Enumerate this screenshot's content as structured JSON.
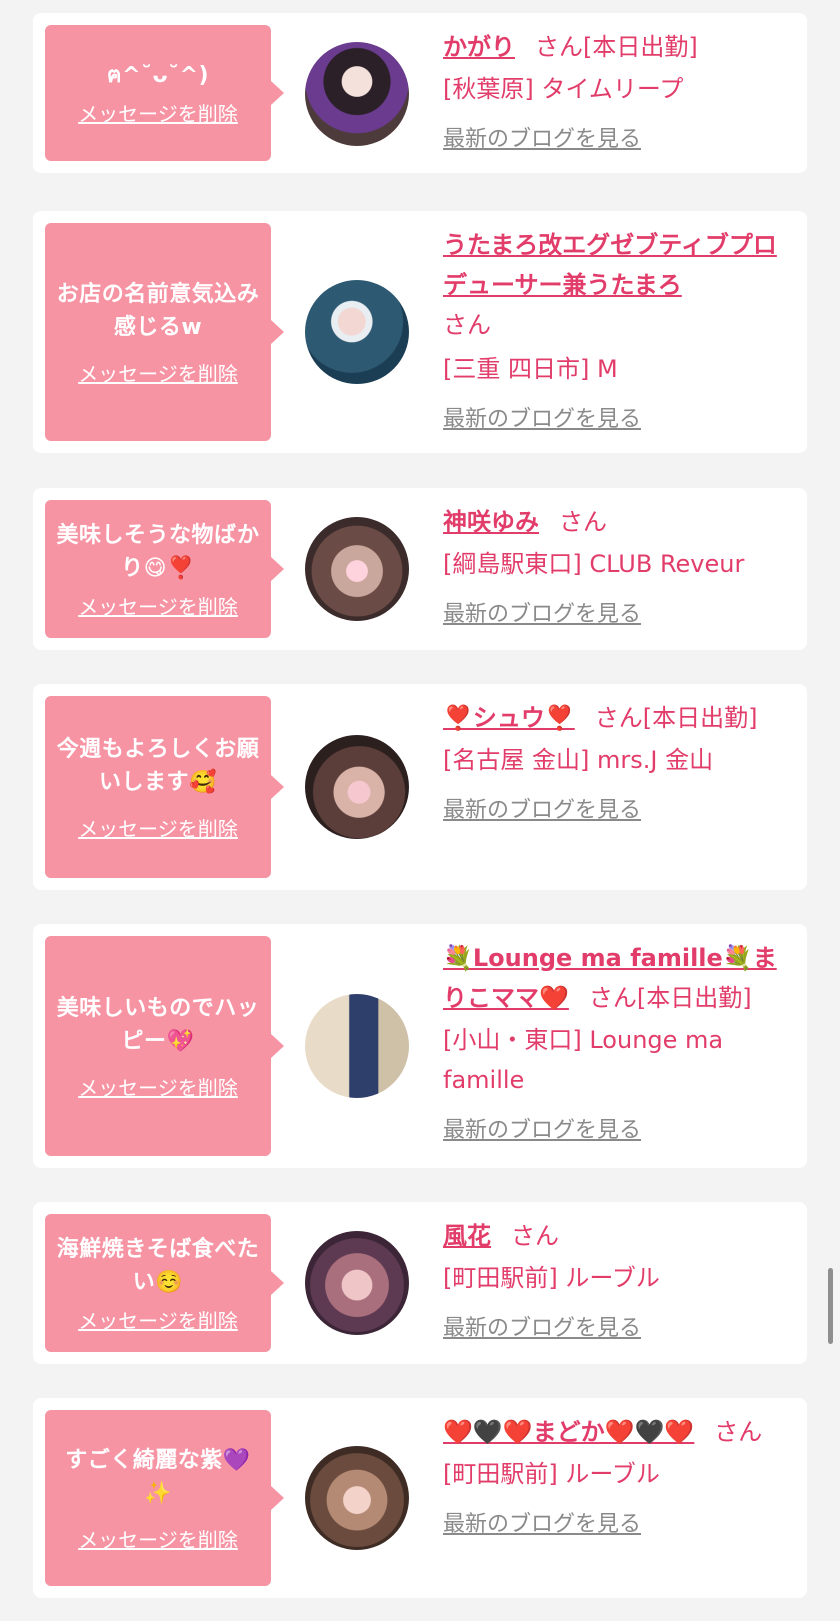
{
  "cards": [
    {
      "bubble_message": "ฅ^˘ᴗ˘^)",
      "delete_label": "メッセージを削除",
      "name": "かがり",
      "honorific": "さん",
      "status": "[本日出勤]",
      "shop": "[秋葉原] タイムリープ",
      "blog_label": "最新のブログを見る"
    },
    {
      "bubble_message": "お店の名前意気込み感じるw",
      "delete_label": "メッセージを削除",
      "name": "うたまろ改エグゼブティブプロデューサー兼うたまろ",
      "honorific": "さん",
      "status": "",
      "shop": "[三重 四日市] M",
      "blog_label": "最新のブログを見る"
    },
    {
      "bubble_message": "美味しそうな物ばかり😋❣️",
      "delete_label": "メッセージを削除",
      "name": "神咲ゆみ",
      "honorific": "さん",
      "status": "",
      "shop": "[綱島駅東口] CLUB Reveur",
      "blog_label": "最新のブログを見る"
    },
    {
      "bubble_message": "今週もよろしくお願いします🥰",
      "delete_label": "メッセージを削除",
      "name": "❣️シュウ❣️",
      "honorific": "さん",
      "status": "[本日出勤]",
      "shop": "[名古屋 金山] mrs.J 金山",
      "blog_label": "最新のブログを見る"
    },
    {
      "bubble_message": "美味しいものでハッピー💖",
      "delete_label": "メッセージを削除",
      "name": "💐Lounge ma famille💐まりこママ❤️",
      "honorific": "さん",
      "status": "[本日出勤]",
      "shop": "[小山・東口] Lounge ma famille",
      "blog_label": "最新のブログを見る"
    },
    {
      "bubble_message": "海鮮焼きそば食べたい☺️",
      "delete_label": "メッセージを削除",
      "name": "風花",
      "honorific": "さん",
      "status": "",
      "shop": "[町田駅前] ルーブル",
      "blog_label": "最新のブログを見る"
    },
    {
      "bubble_message": "すごく綺麗な紫💜✨",
      "delete_label": "メッセージを削除",
      "name": "❤️🖤❤️まどか❤️🖤❤️",
      "honorific": "さん",
      "status": "",
      "shop": "[町田駅前] ルーブル",
      "blog_label": "最新のブログを見る"
    }
  ],
  "colors": {
    "accent": "#e23d6a",
    "bubble": "#f794a4",
    "page_bg": "#f3f3f3",
    "link_gray": "#8a8a8a"
  }
}
